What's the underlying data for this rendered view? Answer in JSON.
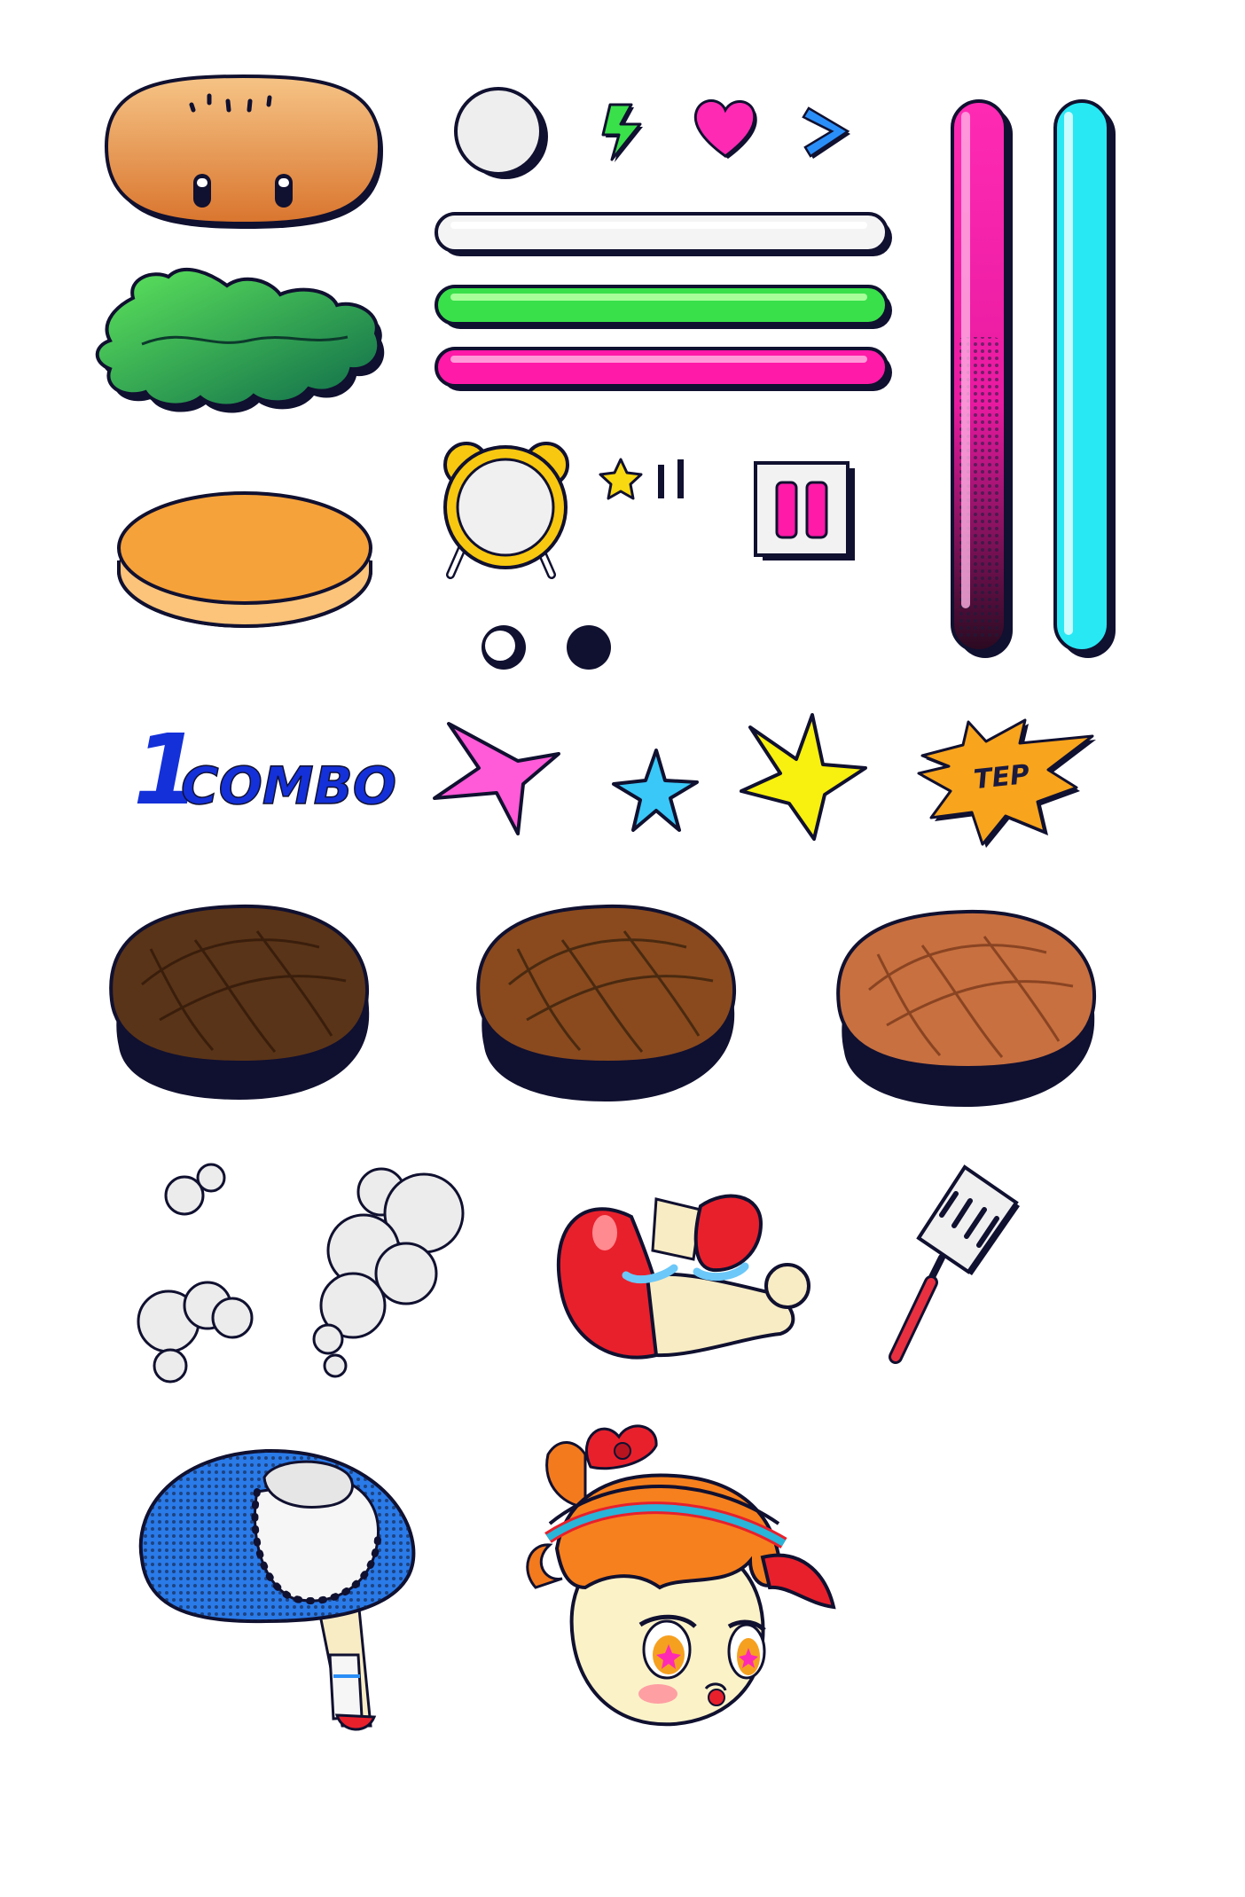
{
  "sprite_sheet": {
    "background": "#ffffff",
    "outline_color": "#101030",
    "combo_label": {
      "count": "1",
      "word": "COMBO",
      "color": "#1430d8"
    },
    "burst_label": "TEP",
    "colors": {
      "bun": "#e8924a",
      "lettuce": "#1f9a52",
      "cheese": "#f6a23a",
      "bar_magenta": "#ff1aa8",
      "bar_cyan": "#28e8f4",
      "bar_green": "#39e04a",
      "star_pink": "#ff5ad8",
      "star_blue": "#3ac8f8",
      "star_yellow": "#f8f00e",
      "patty_dark": "#5a3418",
      "patty_medium": "#8a4a1e",
      "patty_light": "#c87040",
      "clock_gold": "#f8c810",
      "spatula_red": "#e83040"
    },
    "sprites": [
      {
        "icon": "bun-top-icon"
      },
      {
        "icon": "lettuce-icon"
      },
      {
        "icon": "bun-bottom-icon"
      },
      {
        "icon": "button-circle-icon"
      },
      {
        "icon": "lightning-icon"
      },
      {
        "icon": "heart-icon"
      },
      {
        "icon": "chevron-right-icon"
      },
      {
        "icon": "bar-white-icon"
      },
      {
        "icon": "bar-green-icon"
      },
      {
        "icon": "bar-magenta-icon"
      },
      {
        "icon": "vertical-bar-magenta-icon"
      },
      {
        "icon": "vertical-bar-cyan-icon"
      },
      {
        "icon": "alarm-clock-icon"
      },
      {
        "icon": "star-small-icon"
      },
      {
        "icon": "pause-glyph-icon"
      },
      {
        "icon": "pause-button-icon"
      },
      {
        "icon": "dot-open-icon"
      },
      {
        "icon": "dot-filled-icon"
      },
      {
        "icon": "combo-label-icon"
      },
      {
        "icon": "star-pink-icon"
      },
      {
        "icon": "star-blue-icon"
      },
      {
        "icon": "star-yellow-icon"
      },
      {
        "icon": "burst-tep-icon"
      },
      {
        "icon": "patty-dark-icon"
      },
      {
        "icon": "patty-medium-icon"
      },
      {
        "icon": "patty-light-icon"
      },
      {
        "icon": "smoke-small-icon"
      },
      {
        "icon": "smoke-large-icon"
      },
      {
        "icon": "character-arm-icon"
      },
      {
        "icon": "spatula-icon"
      },
      {
        "icon": "character-body-icon"
      },
      {
        "icon": "character-head-icon"
      }
    ]
  }
}
